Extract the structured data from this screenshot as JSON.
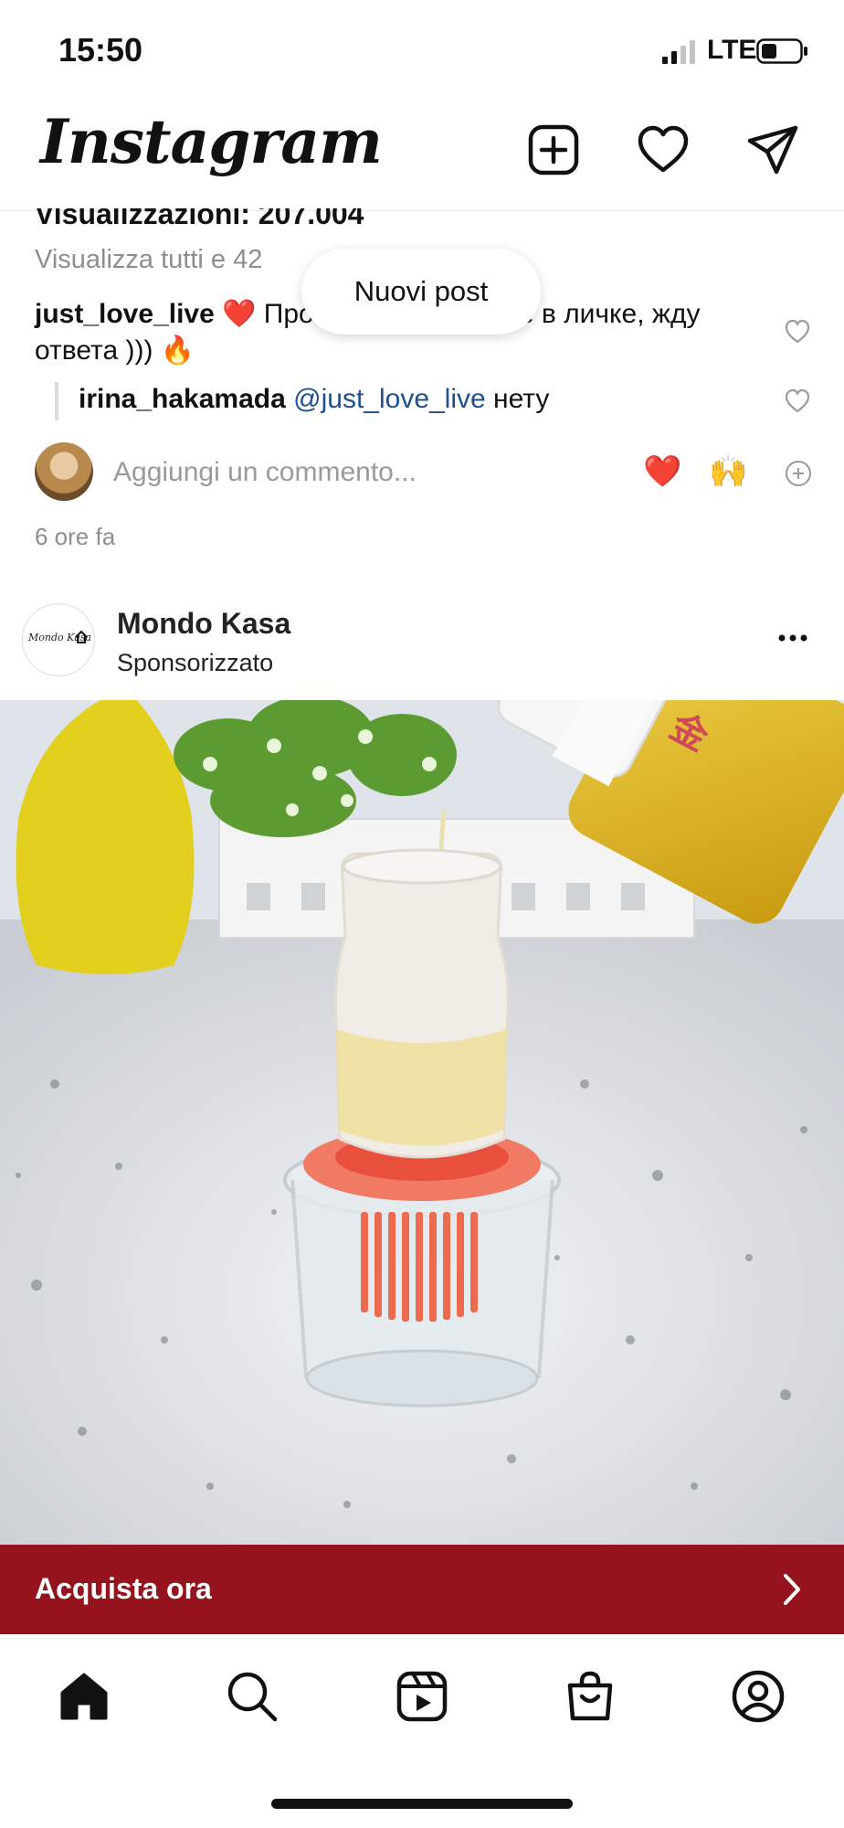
{
  "status_bar": {
    "time": "15:50",
    "carrier": "LTE",
    "signal_bars": 2,
    "battery_level": 0.3
  },
  "header": {
    "logo": "Instagram",
    "icons": [
      "new-post-icon",
      "heart-icon",
      "paper-plane-icon"
    ]
  },
  "previous_post": {
    "views": "Visualizzazioni: 207.004",
    "view_all": "Visualizza tutti e 42",
    "comment": {
      "user": "just_love_live",
      "text": " ❤️ Прочтите сообщение в личке, жду ответа ))) 🔥"
    },
    "reply": {
      "user": "irina_hakamada",
      "mention": "@just_love_live",
      "text": " нету"
    },
    "add_comment_placeholder": "Aggiungi un commento...",
    "quick_emojis": [
      "❤️",
      "🙌"
    ],
    "time_ago": "6 ore fa"
  },
  "new_posts_pill": "Nuovi post",
  "sponsored_post": {
    "account": "Mondo Kasa",
    "label": "Sponsorizzato",
    "avatar_logo_text": "Mondo Kasa",
    "cta": "Acquista ora"
  },
  "nav": {
    "items": [
      "home-icon",
      "search-icon",
      "reels-icon",
      "shop-icon",
      "profile-icon"
    ],
    "active": "home-icon"
  },
  "colors": {
    "cta_background": "#95131c",
    "mention": "#1f4f8f",
    "secondary_text": "#8e8e8e"
  }
}
